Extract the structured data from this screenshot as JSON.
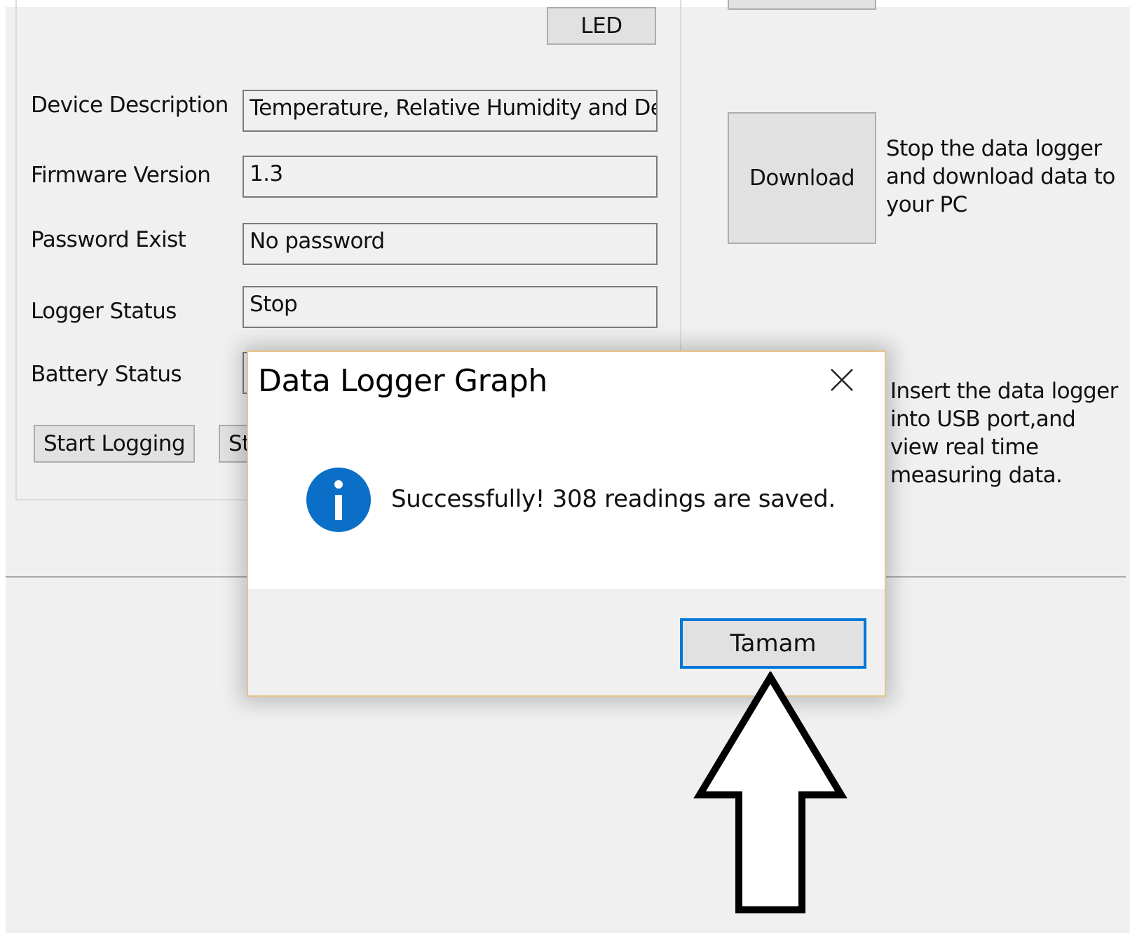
{
  "form": {
    "led_button": "LED",
    "fields": [
      {
        "label": "Device Description",
        "value": "Temperature, Relative Humidity and De"
      },
      {
        "label": "Firmware Version",
        "value": "1.3"
      },
      {
        "label": "Password Exist",
        "value": "No password"
      },
      {
        "label": "Logger Status",
        "value": "Stop"
      },
      {
        "label": "Battery Status",
        "value": ""
      }
    ],
    "start_logging_button": "Start Logging",
    "stop_logging_button_partial": "St"
  },
  "right_panel": {
    "download_button": "Download",
    "download_description": "Stop the data logger and download data to your PC",
    "realtime_description": "Insert the data logger into USB port,and view real time measuring data."
  },
  "dialog": {
    "title": "Data Logger Graph",
    "message": "Successfully! 308 readings are saved.",
    "ok_button": "Tamam",
    "close_icon": "close-icon",
    "info_icon": "info-icon",
    "info_icon_color": "#0b6fc7",
    "focus_color": "#0078d7"
  },
  "annotation": {
    "arrow_icon": "up-arrow-icon"
  }
}
